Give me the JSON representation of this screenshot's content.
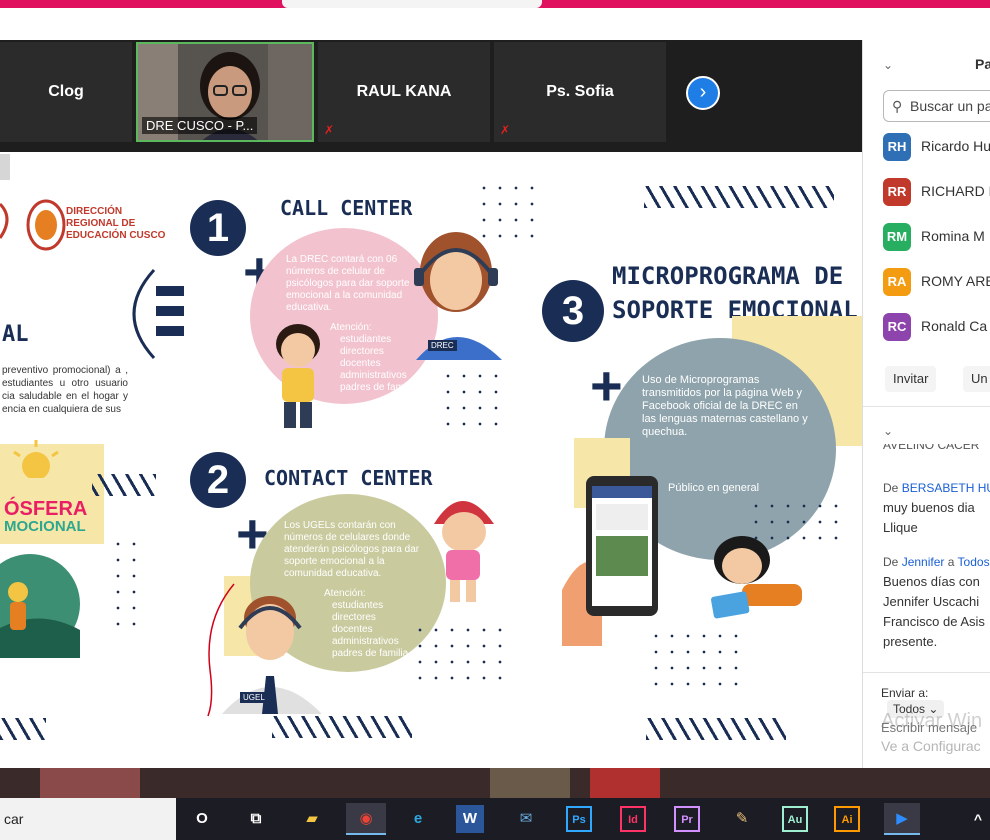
{
  "participants_strip": {
    "tiles": [
      {
        "name": "Clog"
      },
      {
        "name": "DRE CUSCO - P..."
      },
      {
        "name": "RAUL KANA"
      },
      {
        "name": "Ps. Sofia"
      }
    ],
    "next_icon": "chevron-right-icon"
  },
  "slide": {
    "logo_text": "DIRECCIÓN REGIONAL DE EDUCACIÓN CUSCO",
    "left_partial_text": "AL",
    "left_paragraph": "preventivo promocional) a , estudiantes u otro usuario cia saludable en el hogar y encia en cualquiera de sus",
    "left_bottom_text1": "ÓSFERA",
    "left_bottom_text2": "MOCIONAL",
    "s1": {
      "number": "1",
      "title": "CALL CENTER",
      "body": "La DREC contará con 06 números de celular de psicólogos para dar soporte emocional a la comunidad educativa.",
      "atencion_title": "Atención:",
      "items": [
        "estudiantes",
        "directores",
        "docentes",
        "administrativos",
        "padres de familia"
      ],
      "badge": "DREC"
    },
    "s2": {
      "number": "2",
      "title": "CONTACT CENTER",
      "body": "Los UGELs contarán con números de celulares donde atenderán psicólogos para dar soporte emocional a la comunidad educativa.",
      "atencion_title": "Atención:",
      "items": [
        "estudiantes",
        "directores",
        "docentes",
        "administrativos",
        "padres de familia"
      ],
      "badge": "UGEL"
    },
    "s3": {
      "number": "3",
      "title_line1": "MICROPROGRAMA DE",
      "title_line2": "SOPORTE EMOCIONAL",
      "body": "Uso de Microprogramas transmitidos por la página Web y Facebook oficial de la DREC en las lenguas maternas castellano y quechua.",
      "audience": "Público en general"
    }
  },
  "panel": {
    "header": "Pa",
    "search_placeholder": "Buscar un pa",
    "participants": [
      {
        "initials": "RH",
        "name": "Ricardo Hu",
        "color": "#2f6fb6"
      },
      {
        "initials": "RR",
        "name": "RICHARD F",
        "color": "#c0392b"
      },
      {
        "initials": "RM",
        "name": "Romina M",
        "color": "#27ae60"
      },
      {
        "initials": "RA",
        "name": "ROMY ARE",
        "color": "#f39c12"
      },
      {
        "initials": "RC",
        "name": "Ronald Ca",
        "color": "#8e44ad"
      }
    ],
    "invite_label": "Invitar",
    "unmute_label": "Un",
    "chat_cut_line": "AVELINO CACER",
    "messages": [
      {
        "prefix": "De",
        "from": "BERSABETH HU",
        "text": "muy buenos dia Llique"
      },
      {
        "prefix": "De",
        "from": "Jennifer",
        "to_prefix": "a",
        "to": "Todos",
        "text": "Buenos días con Jennifer Uscachi Francisco de Asis presente."
      }
    ],
    "send_to_label": "Enviar a:",
    "send_to_value": "Todos",
    "message_placeholder": "Escribir mensaje",
    "watermark_line1": "Activar Win",
    "watermark_line2": "Ve a Configurac"
  },
  "taskbar": {
    "search_text": "car",
    "apps": [
      {
        "icon": "cortana-icon",
        "glyph": "O"
      },
      {
        "icon": "task-view-icon",
        "glyph": "⧉"
      },
      {
        "icon": "file-explorer-icon",
        "glyph": "▰"
      },
      {
        "icon": "chrome-icon",
        "glyph": "◉"
      },
      {
        "icon": "edge-icon",
        "glyph": "e"
      },
      {
        "icon": "word-icon",
        "glyph": "W"
      },
      {
        "icon": "mail-icon",
        "glyph": "✉"
      },
      {
        "icon": "photoshop-icon",
        "glyph": "Ps"
      },
      {
        "icon": "indesign-icon",
        "glyph": "Id"
      },
      {
        "icon": "premiere-icon",
        "glyph": "Pr"
      },
      {
        "icon": "paint-icon",
        "glyph": "✎"
      },
      {
        "icon": "audition-icon",
        "glyph": "Au"
      },
      {
        "icon": "illustrator-icon",
        "glyph": "Ai"
      },
      {
        "icon": "zoom-icon",
        "glyph": "▶"
      }
    ],
    "tray_icon": "chevron-up-icon"
  }
}
